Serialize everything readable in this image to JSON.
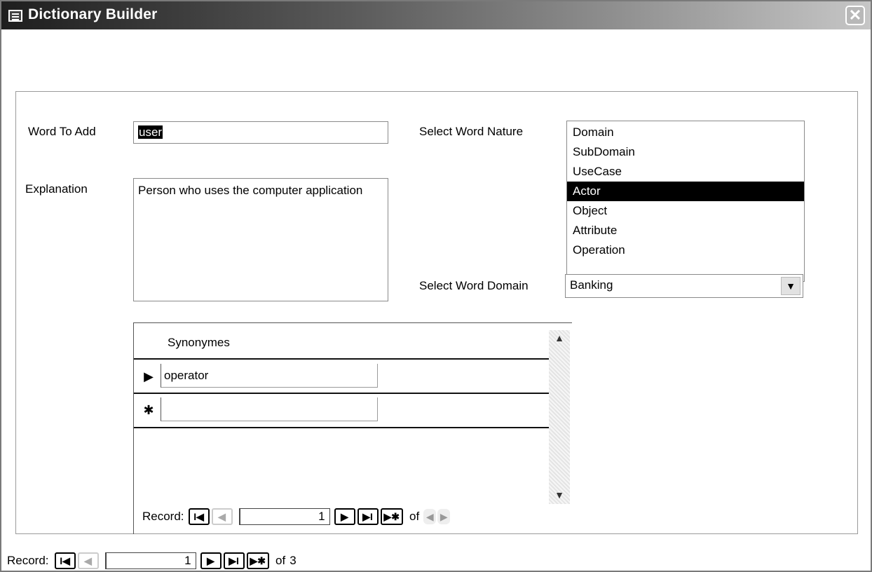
{
  "window": {
    "title": "Dictionary Builder",
    "close_glyph": "✕"
  },
  "form": {
    "word_label": "Word To Add",
    "word_value": "user",
    "explanation_label": "Explanation",
    "explanation_value": "Person who uses the computer application",
    "nature_label": "Select Word Nature",
    "nature_options": [
      "Domain",
      "SubDomain",
      "UseCase",
      "Actor",
      "Object",
      "Attribute",
      "Operation"
    ],
    "nature_selected": "Actor",
    "domain_label": "Select Word Domain",
    "domain_value": "Banking"
  },
  "subform": {
    "header": "Synonymes",
    "rows": [
      {
        "selector": "▶",
        "value": "operator"
      }
    ],
    "new_row_selector": "✱",
    "nav": {
      "label": "Record:",
      "current": "1",
      "of_label": "of",
      "total": ""
    }
  },
  "main_nav": {
    "label": "Record:",
    "current": "1",
    "of_label": "of",
    "total": "3"
  },
  "nav_buttons": {
    "first": "I◀",
    "prev": "◀",
    "next": "▶",
    "last": "▶I",
    "new": "▶✱"
  }
}
